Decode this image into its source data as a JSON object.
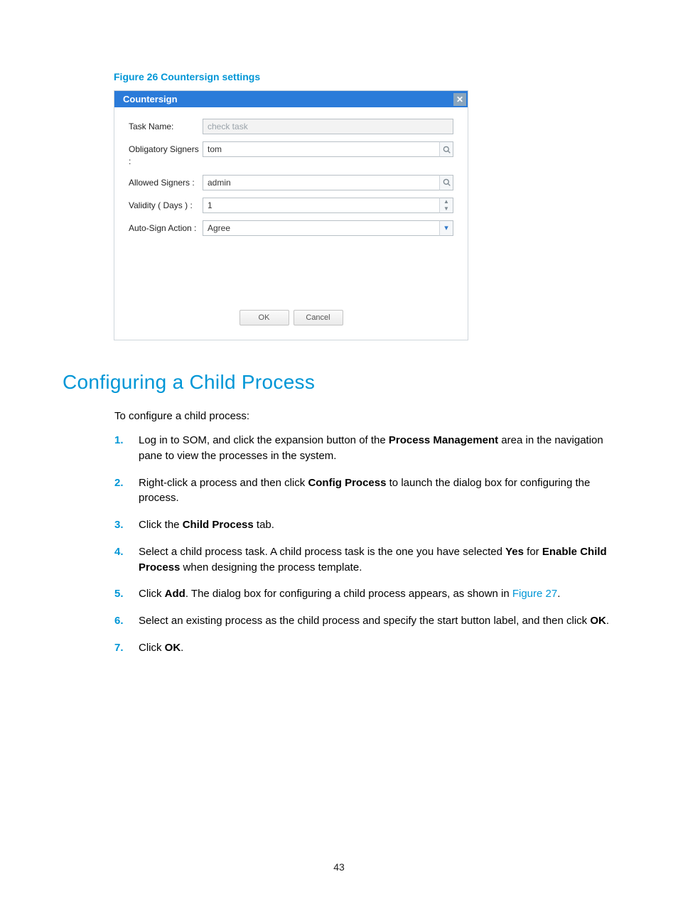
{
  "figure_caption": "Figure 26 Countersign settings",
  "dialog": {
    "title": "Countersign",
    "fields": {
      "task_name": {
        "label": "Task Name:",
        "value": "check task"
      },
      "obligatory": {
        "label": "Obligatory Signers :",
        "value": "tom"
      },
      "allowed": {
        "label": "Allowed Signers :",
        "value": "admin"
      },
      "validity": {
        "label": "Validity ( Days )  :",
        "value": "1"
      },
      "autosign": {
        "label": "Auto-Sign Action :",
        "value": "Agree"
      }
    },
    "buttons": {
      "ok": "OK",
      "cancel": "Cancel"
    }
  },
  "heading": "Configuring a Child Process",
  "lead": "To configure a child process:",
  "steps": [
    {
      "num": "1.",
      "parts": [
        {
          "t": "Log in to SOM, and click the expansion button of the "
        },
        {
          "t": "Process Management",
          "b": true
        },
        {
          "t": " area in the navigation pane to view the processes in the system."
        }
      ]
    },
    {
      "num": "2.",
      "parts": [
        {
          "t": "Right-click a process and then click "
        },
        {
          "t": "Config Process",
          "b": true
        },
        {
          "t": " to launch the dialog box for configuring the process."
        }
      ]
    },
    {
      "num": "3.",
      "parts": [
        {
          "t": "Click the "
        },
        {
          "t": "Child Process",
          "b": true
        },
        {
          "t": " tab."
        }
      ]
    },
    {
      "num": "4.",
      "parts": [
        {
          "t": "Select a child process task. A child process task is the one you have selected "
        },
        {
          "t": "Yes",
          "b": true
        },
        {
          "t": " for "
        },
        {
          "t": "Enable Child Process",
          "b": true
        },
        {
          "t": " when designing the process template."
        }
      ]
    },
    {
      "num": "5.",
      "parts": [
        {
          "t": "Click "
        },
        {
          "t": "Add",
          "b": true
        },
        {
          "t": ". The dialog box for configuring a child process appears, as shown in "
        },
        {
          "t": "Figure 27",
          "link": true
        },
        {
          "t": "."
        }
      ]
    },
    {
      "num": "6.",
      "parts": [
        {
          "t": "Select an existing process as the child process and specify the start button label, and then click "
        },
        {
          "t": "OK",
          "b": true
        },
        {
          "t": "."
        }
      ]
    },
    {
      "num": "7.",
      "parts": [
        {
          "t": "Click "
        },
        {
          "t": "OK",
          "b": true
        },
        {
          "t": "."
        }
      ]
    }
  ],
  "page_number": "43"
}
